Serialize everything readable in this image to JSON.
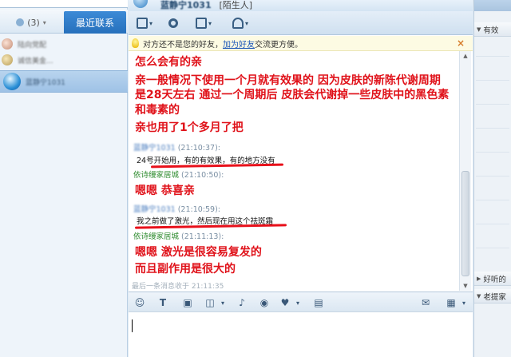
{
  "sidebar": {
    "tabs": {
      "contacts_count": "(3)",
      "recent": "最近联系"
    },
    "contacts": [
      {
        "name": "陆向党配"
      },
      {
        "name": "诚信美金..."
      },
      {
        "name": "蓝静宁1031"
      }
    ]
  },
  "chat": {
    "header": {
      "name": "蓝静宁1031",
      "status": "[陌生人]"
    },
    "notice": {
      "text_before": "对方还不是您的好友，",
      "link": "加为好友",
      "text_after": "交流更方便。",
      "close": "×"
    },
    "messages": {
      "block1": [
        "怎么会有的亲",
        "亲一般情况下使用一个月就有效果的  因为皮肤的新陈代谢周期",
        "是28天左右  通过一个周期后 皮肤会代谢掉一些皮肤中的黑色素",
        "和毒素的",
        "亲也用了1个多月了把"
      ],
      "header2": {
        "sender": "蓝静宁1031",
        "time": "(21:10:37):"
      },
      "msg2": "24号开始用，有的有效果，有的地方没有",
      "header3": {
        "sender": "依诗缦家居城",
        "time": "(21:10:50):"
      },
      "msg3": "嗯嗯  恭喜亲",
      "header4": {
        "sender": "蓝静宁1031",
        "time": "(21:10:59):"
      },
      "msg4": "我之前做了激光，然后现在用这个祛斑霜",
      "header5": {
        "sender": "依诗缦家居城",
        "time": "(21:11:13):"
      },
      "msg5": [
        "嗯嗯  激光是很容易复发的",
        "而且副作用是很大的"
      ]
    },
    "last_message": {
      "label": "最后一条消息收于",
      "time": "21:11:35"
    }
  },
  "right_panel": {
    "sections": [
      "有效",
      "好听的",
      "老提家"
    ]
  },
  "colors": {
    "accent": "#2a78c8",
    "message_red": "#e0121a",
    "underline_red": "#e8101a",
    "sender_green": "#2e8b2e"
  }
}
